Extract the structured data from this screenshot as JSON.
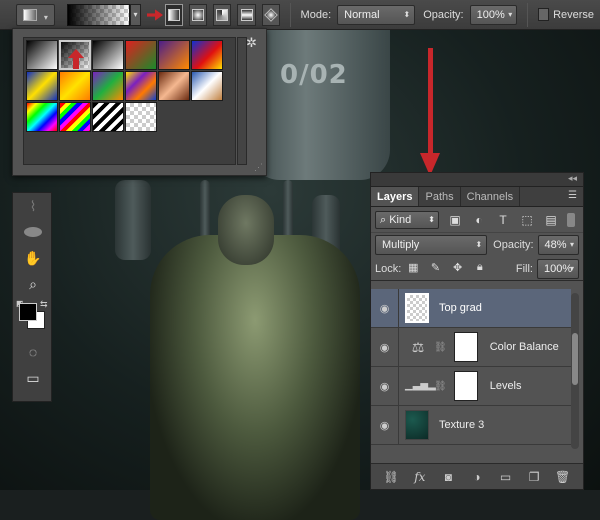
{
  "options_bar": {
    "mode_label": "Mode:",
    "mode_value": "Normal",
    "opacity_label": "Opacity:",
    "opacity_value": "100%",
    "reverse_label": "Reverse",
    "gradient_types": [
      "linear-gradient-icon",
      "radial-gradient-icon",
      "angle-gradient-icon",
      "reflected-gradient-icon",
      "diamond-gradient-icon"
    ],
    "active_gradient_type": "linear-gradient-icon"
  },
  "gradient_picker": {
    "presets": [
      {
        "name": "foreground-to-background",
        "css": "linear-gradient(135deg,#000,#fff)"
      },
      {
        "name": "foreground-to-transparent",
        "css": "linear-gradient(135deg,#000,rgba(0,0,0,0)), repeating-conic-gradient(#ccc 0% 25%, #fff 0% 50%) 0 0/8px 8px"
      },
      {
        "name": "black-white",
        "css": "linear-gradient(135deg,#000,#fff)"
      },
      {
        "name": "red-green",
        "css": "linear-gradient(135deg,#e02020,#1a8a2a)"
      },
      {
        "name": "violet-orange",
        "css": "linear-gradient(135deg,#4b1e8a,#ff8a00)"
      },
      {
        "name": "blue-red-yellow",
        "css": "linear-gradient(135deg,#1030d0,#e01010 55%,#ffe000)"
      },
      {
        "name": "blue-yellow-blue",
        "css": "linear-gradient(135deg,#1030c0,#ffe000 50%,#1030c0)"
      },
      {
        "name": "orange-yellow-orange",
        "css": "linear-gradient(135deg,#ff7a00,#ffe200 50%,#ff7a00)"
      },
      {
        "name": "violet-green-orange",
        "css": "linear-gradient(135deg,#7a20c0,#20b040 50%,#ff8a00)"
      },
      {
        "name": "yellow-violet-orange-blue",
        "css": "linear-gradient(135deg,#ffe000,#7a20c0 35%,#ff7a00 65%,#1040d0)"
      },
      {
        "name": "copper",
        "css": "linear-gradient(135deg,#6a2a10,#f5b890 50%,#6a2a10)"
      },
      {
        "name": "chrome",
        "css": "linear-gradient(135deg,#2a5ab0,#fff 50%,#c08040)"
      },
      {
        "name": "spectrum",
        "css": "linear-gradient(135deg,#f00,#ff0,#0f0,#0ff,#00f,#f0f,#f00)"
      },
      {
        "name": "transparent-rainbow",
        "css": "repeating-linear-gradient(135deg,#f00 0 4px,#ff0 4px 8px,#0f0 8px 12px,#00f 12px 16px,#f0f 16px 20px)"
      },
      {
        "name": "transparent-stripes",
        "css": "repeating-linear-gradient(135deg,#000 0 4px,#fff 4px 8px)"
      },
      {
        "name": "transparent",
        "css": "repeating-conic-gradient(#ccc 0% 25%, #fff 0% 50%) 0 0/8px 8px"
      }
    ],
    "selected_index": 1
  },
  "canvas": {
    "machine_text": "0/02"
  },
  "layers_panel": {
    "tabs": [
      "Layers",
      "Paths",
      "Channels"
    ],
    "active_tab": "Layers",
    "filter_kind": "Kind",
    "blend_mode": "Multiply",
    "opacity_label": "Opacity:",
    "opacity_value": "48%",
    "lock_label": "Lock:",
    "fill_label": "Fill:",
    "fill_value": "100%",
    "layers": [
      {
        "name": "Top grad",
        "type": "pixel",
        "selected": true
      },
      {
        "name": "Color Balance",
        "type": "adjustment-balance",
        "selected": false
      },
      {
        "name": "Levels",
        "type": "adjustment-levels",
        "selected": false
      },
      {
        "name": "Texture 3",
        "type": "pixel-texture",
        "selected": false
      }
    ],
    "footer_icons": [
      "link-icon",
      "fx-icon",
      "mask-icon",
      "adjustment-icon",
      "folder-icon",
      "new-layer-icon",
      "trash-icon"
    ],
    "fx_label": "fx"
  },
  "colors": {
    "accent_arrow": "#c8272b",
    "selected_layer": "#5b667a",
    "panel_bg": "#535353"
  }
}
